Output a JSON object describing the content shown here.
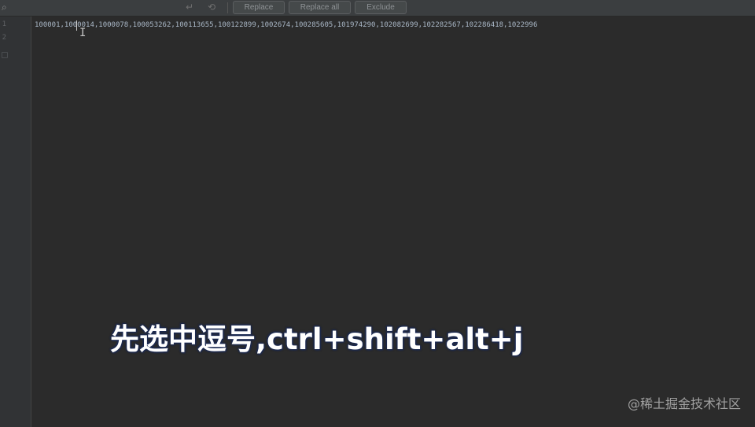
{
  "toolbar": {
    "icons": [
      "search-icon",
      "newline-icon",
      "regex-icon"
    ],
    "buttons": {
      "replace": "Replace",
      "replace_all": "Replace all",
      "exclude": "Exclude"
    }
  },
  "gutter": {
    "line_numbers": [
      "1",
      "2"
    ]
  },
  "editor": {
    "line_1": "100001,1000014,1000078,100053262,100113655,100122899,1002674,100285605,101974290,102082699,102282567,102286418,1022996"
  },
  "overlay": {
    "subtitle": "先选中逗号,ctrl+shift+alt+j",
    "watermark": "@稀土掘金技术社区"
  }
}
